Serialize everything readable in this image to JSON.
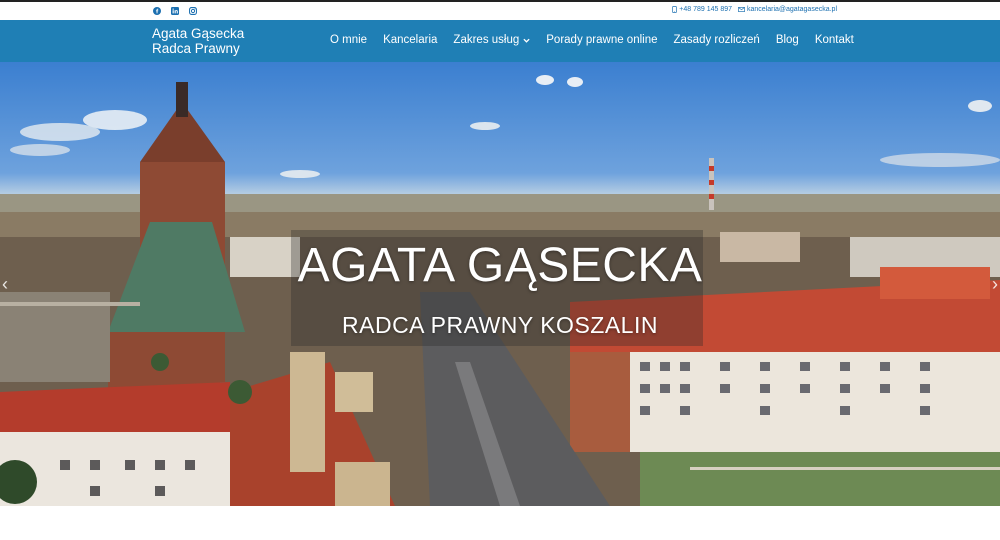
{
  "topbar": {
    "social_icons": [
      "facebook-icon",
      "linkedin-icon",
      "instagram-icon"
    ],
    "phone": "+48 789 145 897",
    "email": "kancelaria@agatagasecka.pl"
  },
  "header": {
    "brand_line1": "Agata Gąsecka",
    "brand_line2": "Radca Prawny",
    "menu": [
      {
        "label": "O mnie"
      },
      {
        "label": "Kancelaria"
      },
      {
        "label": "Zakres usług"
      },
      {
        "label": "Porady prawne online"
      },
      {
        "label": "Zasady rozliczeń"
      },
      {
        "label": "Blog"
      },
      {
        "label": "Kontakt"
      }
    ]
  },
  "hero": {
    "title": "AGATA GĄSECKA",
    "subtitle": "RADCA PRAWNY KOSZALIN",
    "prev_arrow": "‹",
    "next_arrow": "›"
  },
  "colors": {
    "nav": "#1f7fb5",
    "accent": "#1b6fb0",
    "text_light": "#ffffff"
  }
}
